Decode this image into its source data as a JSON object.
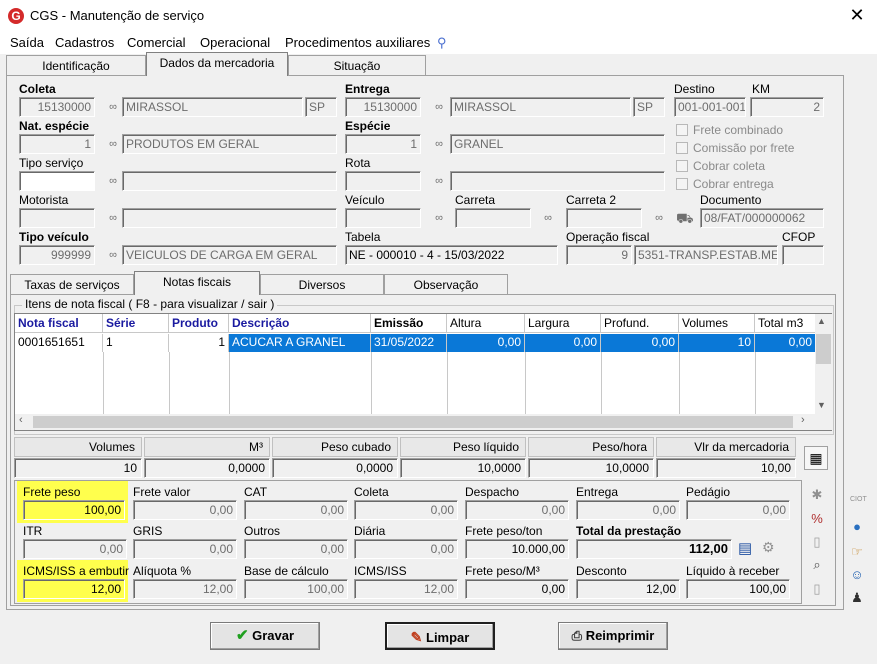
{
  "window": {
    "title": "CGS - Manutenção de serviço",
    "close_glyph": "✕"
  },
  "menu": [
    "Saída",
    "Cadastros",
    "Comercial",
    "Operacional",
    "Procedimentos auxiliares"
  ],
  "tabs": [
    "Identificação",
    "Dados da mercadoria",
    "Situação"
  ],
  "coleta": {
    "label": "Coleta",
    "code": "15130000",
    "city": "MIRASSOL",
    "uf": "SP"
  },
  "entrega": {
    "label": "Entrega",
    "code": "15130000",
    "city": "MIRASSOL",
    "uf": "SP"
  },
  "destino": {
    "label": "Destino",
    "value": "001-001-001"
  },
  "km": {
    "label": "KM",
    "value": "2"
  },
  "nat_especie": {
    "label": "Nat. espécie",
    "code": "1",
    "desc": "PRODUTOS EM GERAL"
  },
  "especie": {
    "label": "Espécie",
    "code": "1",
    "desc": "GRANEL"
  },
  "checks": [
    "Frete combinado",
    "Comissão por frete",
    "Cobrar coleta",
    "Cobrar entrega"
  ],
  "tipo_servico": {
    "label": "Tipo serviço"
  },
  "rota": {
    "label": "Rota"
  },
  "motorista": {
    "label": "Motorista"
  },
  "veiculo": {
    "label": "Veículo"
  },
  "carreta": {
    "label": "Carreta"
  },
  "carreta2": {
    "label": "Carreta 2"
  },
  "documento": {
    "label": "Documento",
    "value": "08/FAT/000000062"
  },
  "tipo_veiculo": {
    "label": "Tipo veículo",
    "code": "999999",
    "desc": "VEICULOS DE CARGA EM GERAL"
  },
  "tabela": {
    "label": "Tabela",
    "value": "NE - 000010 - 4 - 15/03/2022"
  },
  "operacao": {
    "label": "Operação fiscal",
    "code": "9",
    "desc": "5351-TRANSP.ESTAB.ME"
  },
  "cfop": {
    "label": "CFOP"
  },
  "subtabs": [
    "Taxas de serviços",
    "Notas fiscais",
    "Diversos",
    "Observação"
  ],
  "grid": {
    "legend": "Itens de nota fiscal ( F8 - para visualizar / sair )",
    "headers": [
      "Nota fiscal",
      "Série",
      "Produto",
      "Descrição",
      "Emissão",
      "Altura",
      "Largura",
      "Profund.",
      "Volumes",
      "Total m3"
    ],
    "row": [
      "0001651651",
      "1",
      "1",
      "ACUCAR A GRANEL",
      "31/05/2022",
      "0,00",
      "0,00",
      "0,00",
      "10",
      "0,00"
    ]
  },
  "totals": {
    "headers": [
      "Volumes",
      "M³",
      "Peso cubado",
      "Peso líquido",
      "Peso/hora",
      "Vlr da mercadoria"
    ],
    "values": [
      "10",
      "0,0000",
      "0,0000",
      "10,0000",
      "10,0000",
      "10,00"
    ]
  },
  "fields": {
    "frete_peso": {
      "label": "Frete peso",
      "value": "100,00"
    },
    "frete_valor": {
      "label": "Frete valor",
      "value": "0,00"
    },
    "cat": {
      "label": "CAT",
      "value": "0,00"
    },
    "coleta": {
      "label": "Coleta",
      "value": "0,00"
    },
    "despacho": {
      "label": "Despacho",
      "value": "0,00"
    },
    "entrega": {
      "label": "Entrega",
      "value": "0,00"
    },
    "pedagio": {
      "label": "Pedágio",
      "value": "0,00"
    },
    "itr": {
      "label": "ITR",
      "value": "0,00"
    },
    "gris": {
      "label": "GRIS",
      "value": "0,00"
    },
    "outros": {
      "label": "Outros",
      "value": "0,00"
    },
    "diaria": {
      "label": "Diária",
      "value": "0,00"
    },
    "frete_peso_ton": {
      "label": "Frete peso/ton",
      "value": "10.000,00"
    },
    "total_prestacao": {
      "label": "Total da prestação",
      "value": "112,00"
    },
    "icms_embutir": {
      "label": "ICMS/ISS a embutir",
      "value": "12,00"
    },
    "aliquota": {
      "label": "Alíquota %",
      "value": "12,00"
    },
    "base_calculo": {
      "label": "Base de cálculo",
      "value": "100,00"
    },
    "icms_iss": {
      "label": "ICMS/ISS",
      "value": "12,00"
    },
    "frete_peso_m3": {
      "label": "Frete peso/M³",
      "value": "0,00"
    },
    "desconto": {
      "label": "Desconto",
      "value": "12,00"
    },
    "liquido": {
      "label": "Líquido à receber",
      "value": "100,00"
    }
  },
  "buttons": {
    "gravar": "Gravar",
    "limpar": "Limpar",
    "reimprimir": "Reimprimir"
  },
  "side_label": "CIOT",
  "colors": {
    "highlight": "#ffff4d",
    "selection": "#0a78d7",
    "header_text": "#1a1aa0"
  }
}
